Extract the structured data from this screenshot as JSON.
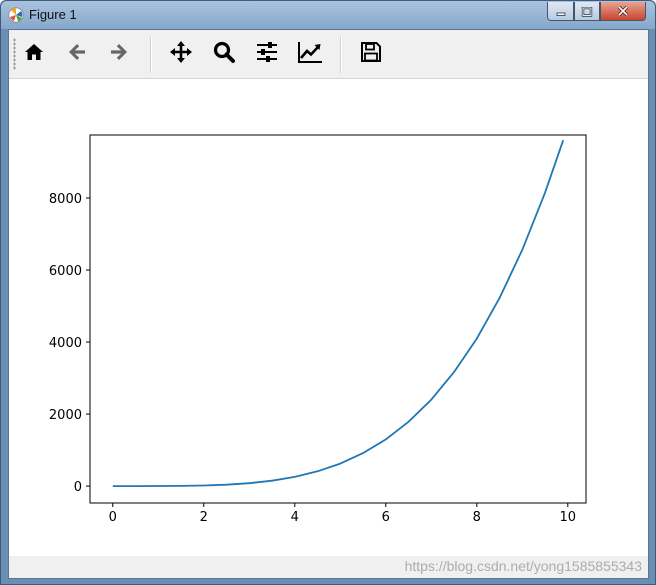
{
  "window": {
    "title": "Figure 1",
    "icon": "matplotlib-icon"
  },
  "toolbar": {
    "buttons": [
      {
        "name": "home",
        "icon": "home-icon"
      },
      {
        "name": "back",
        "icon": "arrow-left-icon"
      },
      {
        "name": "forward",
        "icon": "arrow-right-icon"
      },
      {
        "name": "pan",
        "icon": "move-arrows-icon"
      },
      {
        "name": "zoom",
        "icon": "magnifier-icon"
      },
      {
        "name": "subplots",
        "icon": "sliders-icon"
      },
      {
        "name": "customize",
        "icon": "line-chart-icon"
      },
      {
        "name": "save",
        "icon": "floppy-disk-icon"
      }
    ]
  },
  "watermark": "https://blog.csdn.net/yong1585855343",
  "chart_data": {
    "type": "line",
    "title": "",
    "xlabel": "",
    "ylabel": "",
    "xlim": [
      -0.5,
      10.4
    ],
    "ylim": [
      -470,
      9750
    ],
    "xticks": [
      0,
      2,
      4,
      6,
      8,
      10
    ],
    "yticks": [
      0,
      2000,
      4000,
      6000,
      8000
    ],
    "grid": false,
    "color": "#1f77b4",
    "series": [
      {
        "x": [
          0,
          0.5,
          1,
          1.5,
          2,
          2.5,
          3,
          3.5,
          4,
          4.5,
          5,
          5.5,
          6,
          6.5,
          7,
          7.5,
          8,
          8.5,
          9,
          9.5,
          9.9
        ],
        "values": [
          0,
          0.1,
          1,
          5,
          16,
          39,
          81,
          150,
          256,
          410,
          625,
          915,
          1296,
          1785,
          2401,
          3164,
          4096,
          5220,
          6561,
          8145,
          9606
        ]
      }
    ]
  }
}
